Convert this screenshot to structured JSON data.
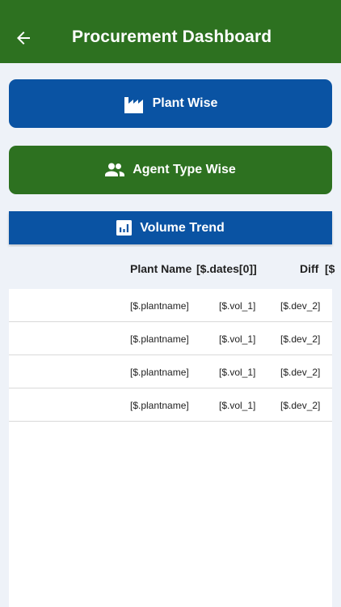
{
  "appbar": {
    "title": "Procurement Dashboard",
    "back_icon": "arrow-left-icon",
    "color": "#2d7120"
  },
  "buttons": {
    "plant_wise": {
      "label": "Plant Wise",
      "icon": "factory-icon",
      "color": "#0a53a3"
    },
    "agent_type_wise": {
      "label": "Agent Type Wise",
      "icon": "people-icon",
      "color": "#2d7120"
    }
  },
  "volume_trend": {
    "label": "Volume Trend",
    "icon": "bar-chart-icon"
  },
  "table": {
    "headers": [
      "Plant Name",
      "[$.dates[0]]",
      "Diff",
      "[$"
    ],
    "rows": [
      {
        "plant": "[$.plantname]",
        "vol": "[$.vol_1]",
        "dev": "[$.dev_2]"
      },
      {
        "plant": "[$.plantname]",
        "vol": "[$.vol_1]",
        "dev": "[$.dev_2]"
      },
      {
        "plant": "[$.plantname]",
        "vol": "[$.vol_1]",
        "dev": "[$.dev_2]"
      },
      {
        "plant": "[$.plantname]",
        "vol": "[$.vol_1]",
        "dev": "[$.dev_2]"
      }
    ]
  }
}
